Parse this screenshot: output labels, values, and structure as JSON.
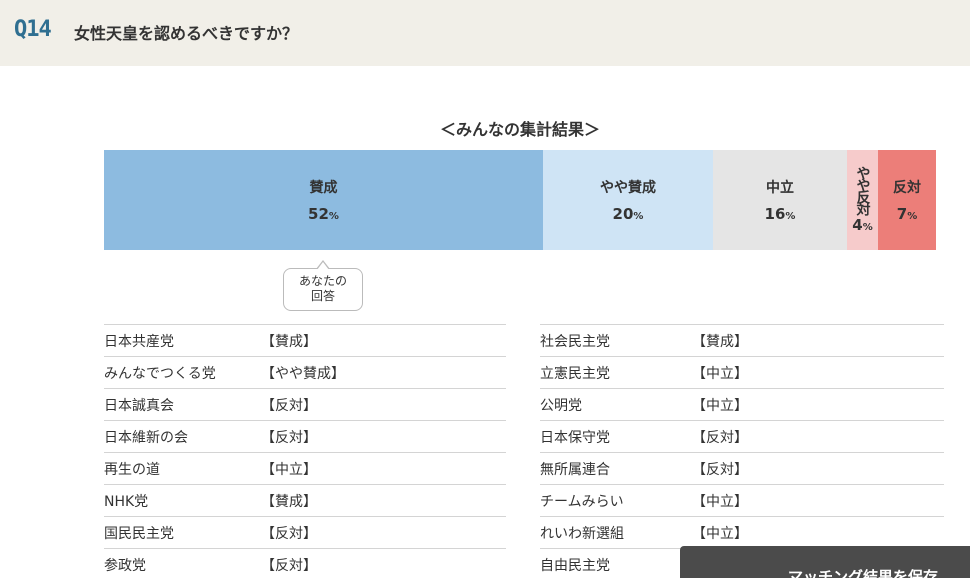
{
  "header": {
    "question_number": "Q14",
    "question": "女性天皇を認めるべきですか？"
  },
  "result_title": "＜みんなの集計結果＞",
  "colors": {
    "agree": "#8dbbe0",
    "somewhat_agree": "#cfe4f5",
    "neutral": "#e5e5e5",
    "somewhat_oppose": "#f6cbcb",
    "oppose": "#ec7e79"
  },
  "distribution": [
    {
      "label": "賛成",
      "value": 52,
      "unit": "%"
    },
    {
      "label": "やや賛成",
      "value": 20,
      "unit": "%"
    },
    {
      "label": "中立",
      "value": 16,
      "unit": "%"
    },
    {
      "label": "やや反対",
      "value": 4,
      "unit": "%"
    },
    {
      "label": "反対",
      "value": 7,
      "unit": "%"
    }
  ],
  "your_answer": {
    "line1": "あなたの",
    "line2": "回答"
  },
  "parties_left": [
    {
      "party": "日本共産党",
      "stance": "【賛成】"
    },
    {
      "party": "みんなでつくる党",
      "stance": "【やや賛成】"
    },
    {
      "party": "日本誠真会",
      "stance": "【反対】"
    },
    {
      "party": "日本維新の会",
      "stance": "【反対】"
    },
    {
      "party": "再生の道",
      "stance": "【中立】"
    },
    {
      "party": "NHK党",
      "stance": "【賛成】"
    },
    {
      "party": "国民民主党",
      "stance": "【反対】"
    },
    {
      "party": "参政党",
      "stance": "【反対】"
    }
  ],
  "parties_right": [
    {
      "party": "社会民主党",
      "stance": "【賛成】"
    },
    {
      "party": "立憲民主党",
      "stance": "【中立】"
    },
    {
      "party": "公明党",
      "stance": "【中立】"
    },
    {
      "party": "日本保守党",
      "stance": "【反対】"
    },
    {
      "party": "無所属連合",
      "stance": "【反対】"
    },
    {
      "party": "チームみらい",
      "stance": "【中立】"
    },
    {
      "party": "れいわ新選組",
      "stance": "【中立】"
    },
    {
      "party": "自由民主党",
      "stance": ""
    }
  ],
  "overlay": {
    "text": "マッチング結果を保存"
  }
}
